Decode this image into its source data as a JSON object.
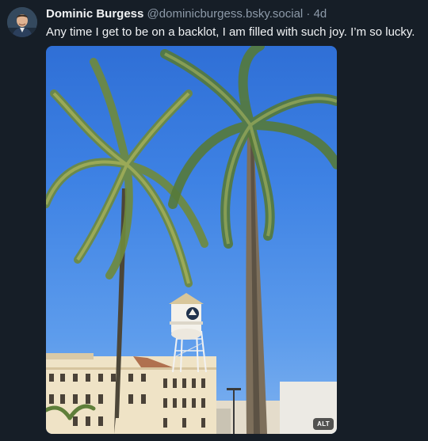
{
  "post": {
    "author": {
      "display_name": "Dominic Burgess",
      "handle": "@dominicburgess.bsky.social",
      "separator": "·",
      "time_ago": "4d"
    },
    "text": "Any time I get to be on a backlot, I am filled with such joy. I’m so lucky.",
    "media": {
      "alt_badge": "ALT",
      "icon": "photo"
    }
  },
  "colors": {
    "background": "#161e27",
    "text_primary": "#f1f3f5",
    "text_secondary": "#8d9aa9",
    "sky": "#3e82e4"
  }
}
